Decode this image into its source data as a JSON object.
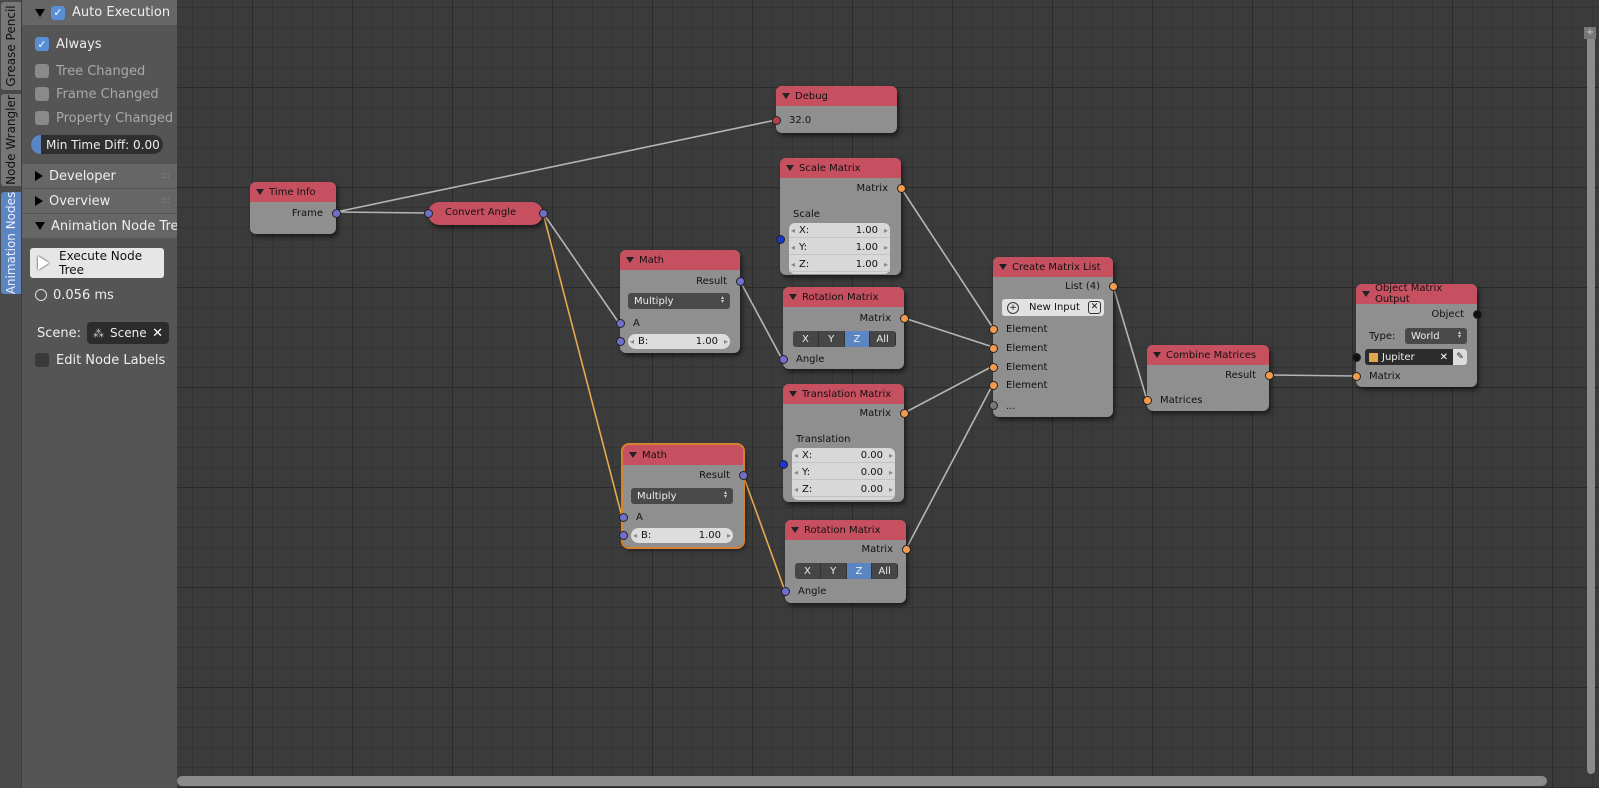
{
  "tabs": [
    "Grease Pencil",
    "Node Wrangler",
    "Animation Nodes"
  ],
  "panel": {
    "auto_execution": "Auto Execution",
    "always": "Always",
    "tree_changed": "Tree Changed",
    "frame_changed": "Frame Changed",
    "property_changed": "Property Changed",
    "min_time_diff": "Min Time Diff: 0.00",
    "developer": "Developer",
    "overview": "Overview",
    "anim_tree": "Animation Node Tree",
    "execute": "Execute Node Tree",
    "exec_time": "0.056 ms",
    "scene_label": "Scene:",
    "scene_value": "Scene",
    "edit_labels": "Edit Node Labels"
  },
  "nodes": {
    "time_info": {
      "title": "Time Info",
      "frame": "Frame"
    },
    "convert_angle": {
      "title": "Convert Angle"
    },
    "debug": {
      "title": "Debug",
      "value": "32.0"
    },
    "math1": {
      "title": "Math",
      "result": "Result",
      "op": "Multiply",
      "a": "A",
      "b_key": "B:",
      "b_val": "1.00"
    },
    "math2": {
      "title": "Math",
      "result": "Result",
      "op": "Multiply",
      "a": "A",
      "b_key": "B:",
      "b_val": "1.00"
    },
    "scale_matrix": {
      "title": "Scale Matrix",
      "matrix": "Matrix",
      "scale": "Scale",
      "x_key": "X:",
      "x_val": "1.00",
      "y_key": "Y:",
      "y_val": "1.00",
      "z_key": "Z:",
      "z_val": "1.00"
    },
    "rot1": {
      "title": "Rotation Matrix",
      "matrix": "Matrix",
      "angle": "Angle",
      "axes": [
        "X",
        "Y",
        "Z",
        "All"
      ],
      "selected_axis": "Z"
    },
    "translation": {
      "title": "Translation Matrix",
      "matrix": "Matrix",
      "translation": "Translation",
      "x_key": "X:",
      "x_val": "0.00",
      "y_key": "Y:",
      "y_val": "0.00",
      "z_key": "Z:",
      "z_val": "0.00"
    },
    "rot2": {
      "title": "Rotation Matrix",
      "matrix": "Matrix",
      "angle": "Angle",
      "axes": [
        "X",
        "Y",
        "Z",
        "All"
      ],
      "selected_axis": "Z"
    },
    "create_list": {
      "title": "Create Matrix List",
      "list": "List (4)",
      "new_input": "New Input",
      "element": "Element",
      "more": "..."
    },
    "combine": {
      "title": "Combine Matrices",
      "result": "Result",
      "matrices": "Matrices"
    },
    "output": {
      "title": "Object Matrix Output",
      "object": "Object",
      "type_label": "Type:",
      "type_value": "World",
      "object_value": "Jupiter",
      "matrix": "Matrix"
    }
  },
  "colors": {
    "node_header": "#c75060",
    "link_wire": "#b5b5b5",
    "angle_wire": "#e7a84f",
    "socket_matrix": "#f39b4c",
    "socket_float": "#6f6fcc",
    "selected_accent": "#5b86c1"
  }
}
